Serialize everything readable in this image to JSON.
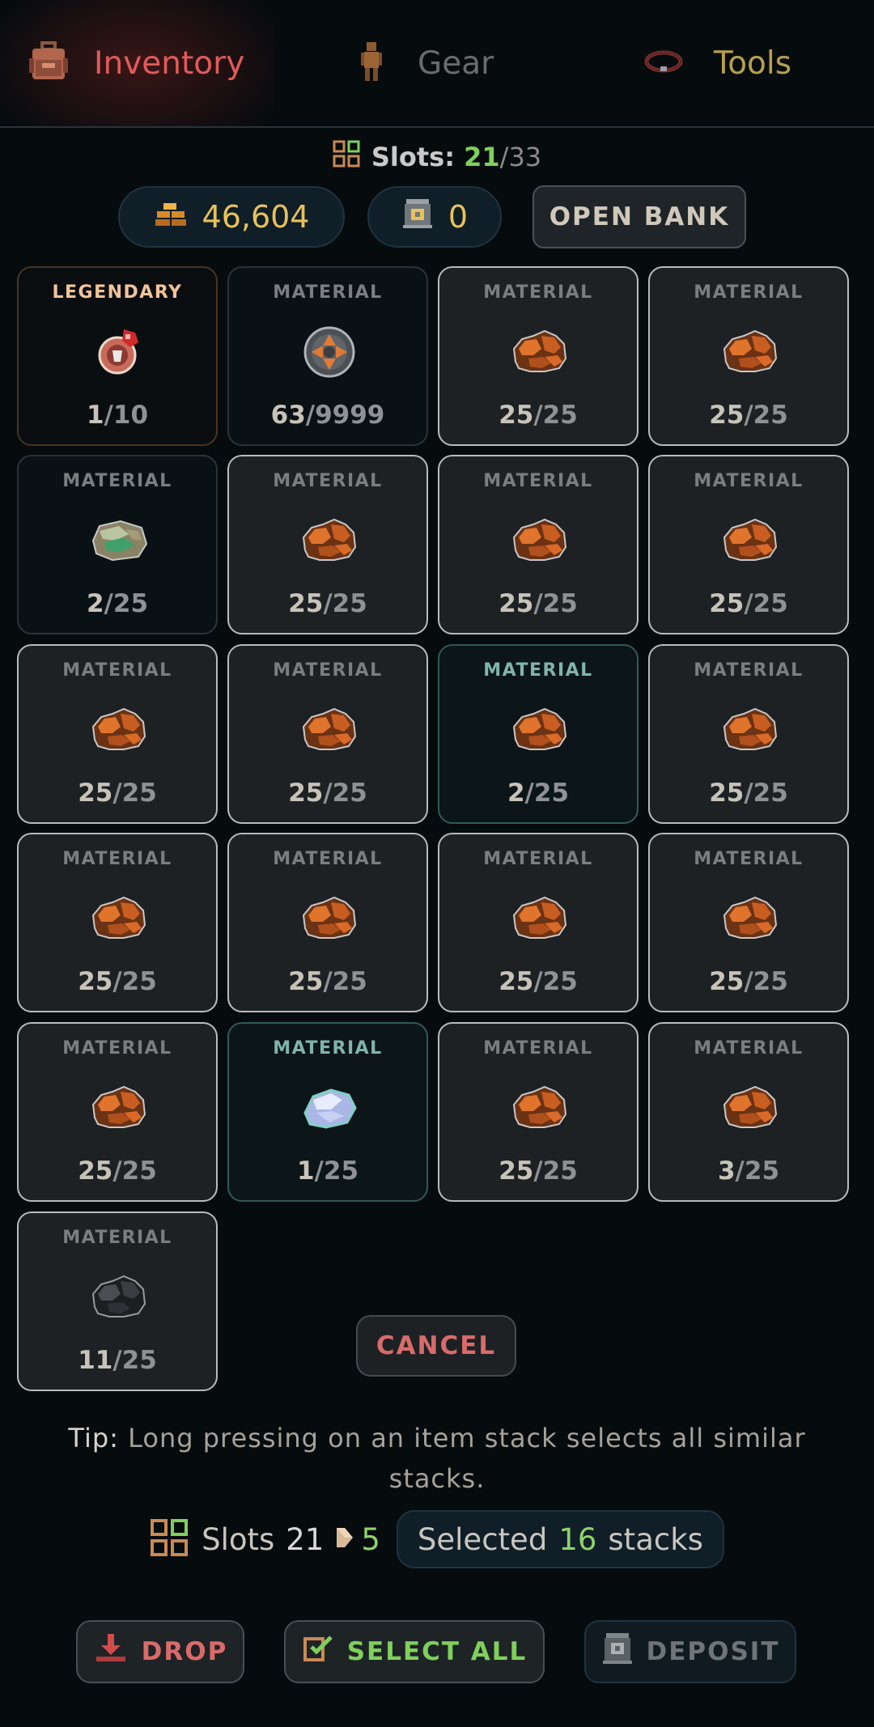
{
  "tabs": [
    {
      "label": "Inventory",
      "icon": "backpack-icon",
      "active": true
    },
    {
      "label": "Gear",
      "icon": "person-icon",
      "active": false
    },
    {
      "label": "Tools",
      "icon": "tool-ring-icon",
      "active": false
    }
  ],
  "slots": {
    "label": "Slots:",
    "used": "21",
    "separator": "/",
    "total": "33"
  },
  "currency": {
    "gold": "46,604",
    "bank": "0"
  },
  "open_bank_label": "OPEN BANK",
  "items": [
    {
      "type": "LEGENDARY",
      "icon": "amulet-icon",
      "count": "1",
      "max": "10"
    },
    {
      "type": "MATERIAL",
      "icon": "gear-disc-icon",
      "count": "63",
      "max": "9999"
    },
    {
      "type": "MATERIAL",
      "icon": "copper-ore-icon",
      "count": "25",
      "max": "25"
    },
    {
      "type": "MATERIAL",
      "icon": "copper-ore-icon",
      "count": "25",
      "max": "25"
    },
    {
      "type": "MATERIAL",
      "icon": "green-ore-icon",
      "count": "2",
      "max": "25"
    },
    {
      "type": "MATERIAL",
      "icon": "copper-ore-icon",
      "count": "25",
      "max": "25"
    },
    {
      "type": "MATERIAL",
      "icon": "copper-ore-icon",
      "count": "25",
      "max": "25"
    },
    {
      "type": "MATERIAL",
      "icon": "copper-ore-icon",
      "count": "25",
      "max": "25"
    },
    {
      "type": "MATERIAL",
      "icon": "copper-ore-icon",
      "count": "25",
      "max": "25"
    },
    {
      "type": "MATERIAL",
      "icon": "copper-ore-icon",
      "count": "25",
      "max": "25"
    },
    {
      "type": "MATERIAL",
      "icon": "copper-ore-icon",
      "count": "2",
      "max": "25"
    },
    {
      "type": "MATERIAL",
      "icon": "copper-ore-icon",
      "count": "25",
      "max": "25"
    },
    {
      "type": "MATERIAL",
      "icon": "copper-ore-icon",
      "count": "25",
      "max": "25"
    },
    {
      "type": "MATERIAL",
      "icon": "copper-ore-icon",
      "count": "25",
      "max": "25"
    },
    {
      "type": "MATERIAL",
      "icon": "copper-ore-icon",
      "count": "25",
      "max": "25"
    },
    {
      "type": "MATERIAL",
      "icon": "copper-ore-icon",
      "count": "25",
      "max": "25"
    },
    {
      "type": "MATERIAL",
      "icon": "copper-ore-icon",
      "count": "25",
      "max": "25"
    },
    {
      "type": "MATERIAL",
      "icon": "white-crystal-icon",
      "count": "1",
      "max": "25"
    },
    {
      "type": "MATERIAL",
      "icon": "copper-ore-icon",
      "count": "25",
      "max": "25"
    },
    {
      "type": "MATERIAL",
      "icon": "copper-ore-icon",
      "count": "3",
      "max": "25"
    },
    {
      "type": "MATERIAL",
      "icon": "coal-ore-icon",
      "count": "11",
      "max": "25"
    }
  ],
  "cancel_label": "CANCEL",
  "tip": {
    "prefix": "Tip:",
    "text": "Long pressing on an item stack selects all similar stacks."
  },
  "selection": {
    "slots_label": "Slots",
    "slots_value": "21",
    "freed": "5",
    "selected_prefix": "Selected",
    "selected_count": "16",
    "selected_suffix": "stacks"
  },
  "actions": {
    "drop": "DROP",
    "select_all": "SELECT ALL",
    "deposit": "DEPOSIT"
  },
  "colors": {
    "accent_red": "#e25a5a",
    "accent_green": "#7fcf5c",
    "gold": "#e7c25a",
    "tools": "#b5a04e"
  }
}
